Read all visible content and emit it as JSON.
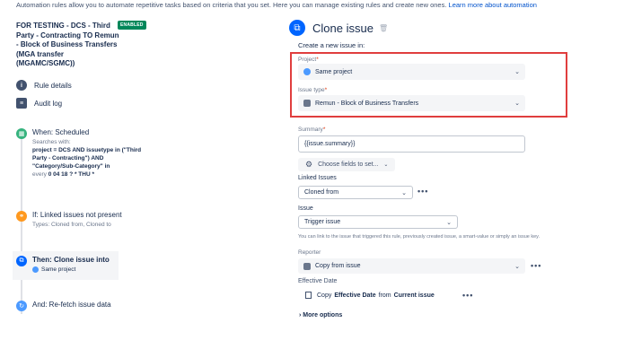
{
  "intro": {
    "text": "Automation rules allow you to automate repetitive tasks based on criteria that you set. Here you can manage existing rules and create new ones. ",
    "link": "Learn more about automation"
  },
  "rule": {
    "title": "FOR TESTING - DCS - Third Party - Contracting TO Remun - Block of Business Transfers (MGA transfer (MGAMC/SGMC))",
    "badge": "ENABLED"
  },
  "nav": {
    "rule_details": "Rule details",
    "audit_log": "Audit log"
  },
  "steps": {
    "when": {
      "title": "When: Scheduled",
      "line1": "Searches with:",
      "jql": "project = DCS AND issuetype in (\"Third Party - Contracting\") AND \"Category/Sub-Category\" in",
      "every_prefix": "every ",
      "cron": "0 04 18 ? * THU *",
      "color": "#36b37e"
    },
    "if": {
      "title": "If: Linked issues not present",
      "sub": "Types: Cloned from, Cloned to",
      "color": "#ff991f"
    },
    "then": {
      "title": "Then: Clone issue into",
      "sub": "Same project",
      "color": "#0065ff"
    },
    "and": {
      "title": "And: Re-fetch issue data",
      "color": "#4c9aff"
    }
  },
  "panel": {
    "title": "Clone issue",
    "create_text": "Create a new issue in:",
    "project_label": "Project",
    "project_value": "Same project",
    "issuetype_label": "Issue type",
    "issuetype_value": "Remun - Block of Business Transfers",
    "summary_label": "Summary",
    "summary_value": "{{issue.summary}}",
    "choose_fields": "Choose fields to set...",
    "linked_label": "Linked Issues",
    "linked_value": "Cloned from",
    "issue_label": "Issue",
    "issue_value": "Trigger issue",
    "hint": "You can link to the issue that triggered this rule, previously created issue, a smart-value or simply an issue key.",
    "reporter_label": "Reporter",
    "reporter_value": "Copy from issue",
    "effective_label": "Effective Date",
    "copy_word": "Copy",
    "copy_field": "Effective Date",
    "copy_from": "from",
    "copy_source": "Current issue",
    "more_options": "More options",
    "req_mark": "*",
    "dots": "•••"
  },
  "colors": {
    "accent": "#0052cc",
    "highlight": "#e03e3e",
    "badge": "#00875a"
  }
}
